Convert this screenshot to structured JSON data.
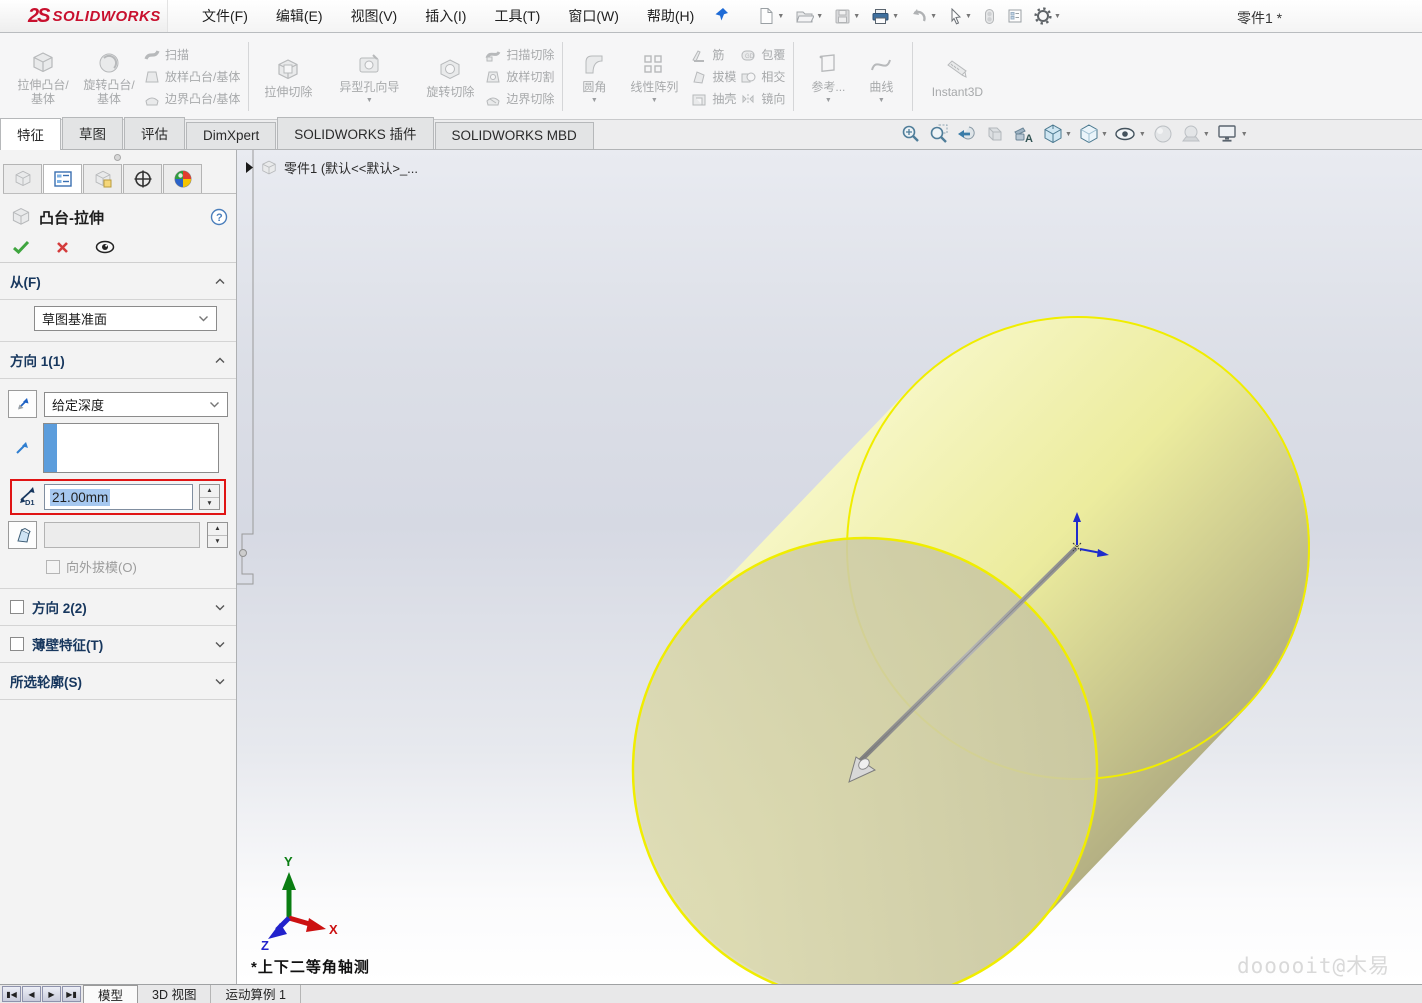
{
  "window": {
    "logo_text": "SOLIDWORKS",
    "logo_mark": "2S",
    "doc_title": "零件1 *"
  },
  "menu": {
    "items": [
      "文件(F)",
      "编辑(E)",
      "视图(V)",
      "插入(I)",
      "工具(T)",
      "窗口(W)",
      "帮助(H)"
    ]
  },
  "quick_access_icons": [
    "new-document",
    "open",
    "save",
    "print",
    "undo",
    "select",
    "rebuild",
    "file-properties",
    "options-gear"
  ],
  "ribbon": {
    "groups": [
      {
        "big": [
          "拉伸凸台/基体",
          "旋转凸台/基体"
        ],
        "stack": [
          "扫描",
          "放样凸台/基体",
          "边界凸台/基体"
        ]
      },
      {
        "big": [
          "拉伸切除",
          "异型孔向导",
          "旋转切除"
        ],
        "stack": [
          "扫描切除",
          "放样切割",
          "边界切除"
        ]
      },
      {
        "big": [
          "圆角",
          "线性阵列"
        ],
        "stack1": [
          "筋",
          "拔模",
          "抽壳"
        ],
        "stack2": [
          "包覆",
          "相交",
          "镜向"
        ]
      },
      {
        "big": [
          "参考...",
          "曲线"
        ]
      },
      {
        "big": [
          "Instant3D"
        ]
      }
    ]
  },
  "command_tabs": [
    "特征",
    "草图",
    "评估",
    "DimXpert",
    "SOLIDWORKS 插件",
    "SOLIDWORKS MBD"
  ],
  "headsup_icons": [
    "zoom-fit",
    "zoom-area",
    "previous-view",
    "section-view",
    "dynamic-annotation-views",
    "view-orientation",
    "display-style",
    "hide-show-items",
    "edit-appearance",
    "apply-scene",
    "view-settings"
  ],
  "property_manager": {
    "title": "凸台-拉伸",
    "from": {
      "label": "从(F)",
      "value": "草图基准面"
    },
    "direction1": {
      "label": "方向 1(1)",
      "end_condition": "给定深度",
      "depth": "21.00mm",
      "draft_outward": "向外拔模(O)"
    },
    "direction2": {
      "label": "方向 2(2)"
    },
    "thin_feature": {
      "label": "薄壁特征(T)"
    },
    "selected_contours": {
      "label": "所选轮廓(S)"
    }
  },
  "viewport": {
    "feature_tree_node": "零件1 (默认<<默认>_...",
    "orientation_label": "*上下二等角轴测",
    "watermark": "dooooit@木易",
    "triad": {
      "x_label": "X",
      "y_label": "Y",
      "z_label": "Z"
    },
    "colors": {
      "preview_edge": "#f0ed00",
      "body_light": "#f6f6c4",
      "body_dark": "#b4b083",
      "front_face": "#d5d3b0",
      "highlight_red": "#e01414",
      "selection_blue": "#a6c8f0"
    }
  },
  "bottom_bar": {
    "tabs": [
      "模型",
      "3D 视图",
      "运动算例 1"
    ],
    "active_tab": "模型"
  }
}
